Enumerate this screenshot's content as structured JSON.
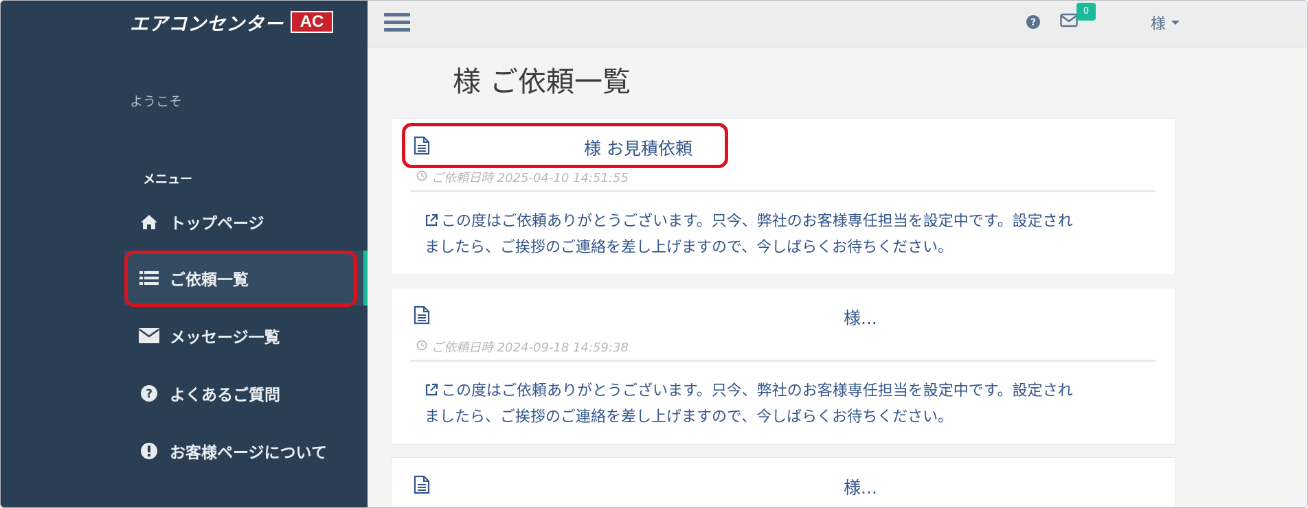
{
  "sidebar": {
    "logo_text": "エアコンセンター",
    "logo_mark": "AC",
    "welcome": "ようこそ",
    "menu_heading": "メニュー",
    "items": [
      {
        "label": "トップページ",
        "icon": "home-icon"
      },
      {
        "label": "ご依頼一覧",
        "icon": "list-icon",
        "active": true
      },
      {
        "label": "メッセージ一覧",
        "icon": "envelope-icon"
      },
      {
        "label": "よくあるご質問",
        "icon": "question-circle-icon"
      },
      {
        "label": "お客様ページについて",
        "icon": "exclamation-circle-icon"
      }
    ]
  },
  "topbar": {
    "message_badge": "0",
    "user_label": "様"
  },
  "main": {
    "page_title": "様 ご依頼一覧",
    "requests": [
      {
        "title": "様 お見積依頼",
        "date": "ご依頼日時 2025-04-10 14:51:55",
        "message_line1": "この度はご依頼ありがとうございます。只今、弊社のお客様専任担当を設定中です。設定され",
        "message_line2": "ましたら、ご挨拶のご連絡を差し上げますので、今しばらくお待ちください。"
      },
      {
        "title": "様...",
        "date": "ご依頼日時 2024-09-18 14:59:38",
        "message_line1": "この度はご依頼ありがとうございます。只今、弊社のお客様専任担当を設定中です。設定され",
        "message_line2": "ましたら、ご挨拶のご連絡を差し上げますので、今しばらくお待ちください。"
      },
      {
        "title": "様..."
      }
    ]
  },
  "colors": {
    "sidebar_bg": "#2a3f54",
    "accent": "#1abb9c",
    "highlight": "#d6131f",
    "link": "#34568b"
  }
}
